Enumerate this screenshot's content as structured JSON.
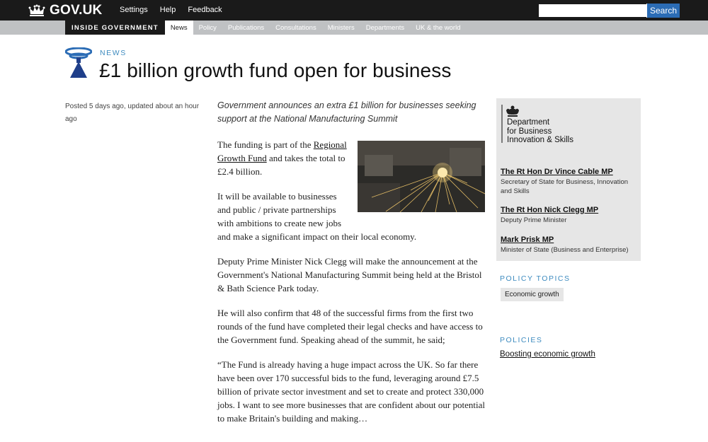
{
  "header": {
    "logo_text": "GOV.UK",
    "nav": [
      "Settings",
      "Help",
      "Feedback"
    ],
    "search_placeholder": "",
    "search_button": "Search"
  },
  "subnav": {
    "section": "INSIDE GOVERNMENT",
    "items": [
      "News",
      "Policy",
      "Publications",
      "Consultations",
      "Ministers",
      "Departments",
      "UK & the world"
    ],
    "active": "News"
  },
  "article": {
    "kicker": "NEWS",
    "title": "£1 billion growth fund open for business",
    "meta": "Posted 5 days ago, updated about an hour ago",
    "lede": "Government announces an extra £1 billion for businesses seeking support at the National Manufacturing Summit",
    "p1_before": "The funding is part of the ",
    "p1_link": "Regional Growth Fund",
    "p1_after": " and takes the total to £2.4 billion.",
    "p2": "It will be available to businesses and public / private partnerships with ambitions to create new jobs and make a significant impact on their local economy.",
    "p3": "Deputy Prime Minister Nick Clegg will make the announcement at the Government's National Manufacturing Summit being held at the Bristol & Bath Science Park today.",
    "p4": "He will also confirm that 48 of the successful firms from the first two rounds of the fund have completed their legal checks and have access to the Government fund. Speaking ahead of the summit, he said;",
    "p5": "“The Fund is already having a huge impact across the UK. So far there have been over 170 successful bids to the fund, leveraging around £7.5 billion of private sector investment and set to create and protect 330,000 jobs. I want to see more businesses that are confident about our potential to make Britain's building and making…"
  },
  "sidebar": {
    "org_name": [
      "Department",
      "for Business",
      "Innovation & Skills"
    ],
    "ministers": [
      {
        "name": "The Rt Hon Dr Vince Cable MP",
        "role": "Secretary of State for Business, Innovation and Skills"
      },
      {
        "name": "The Rt Hon Nick Clegg MP",
        "role": "Deputy Prime Minister"
      },
      {
        "name": "Mark Prisk MP",
        "role": "Minister of State (Business and Enterprise)"
      }
    ],
    "topics_heading": "POLICY TOPICS",
    "topic": "Economic growth",
    "policies_heading": "POLICIES",
    "policy": "Boosting economic growth"
  },
  "colors": {
    "topbar": "#1a1a1a",
    "subbar": "#bfc1c3",
    "accent_blue": "#3d8bbf",
    "search_button": "#2b6cb5"
  }
}
